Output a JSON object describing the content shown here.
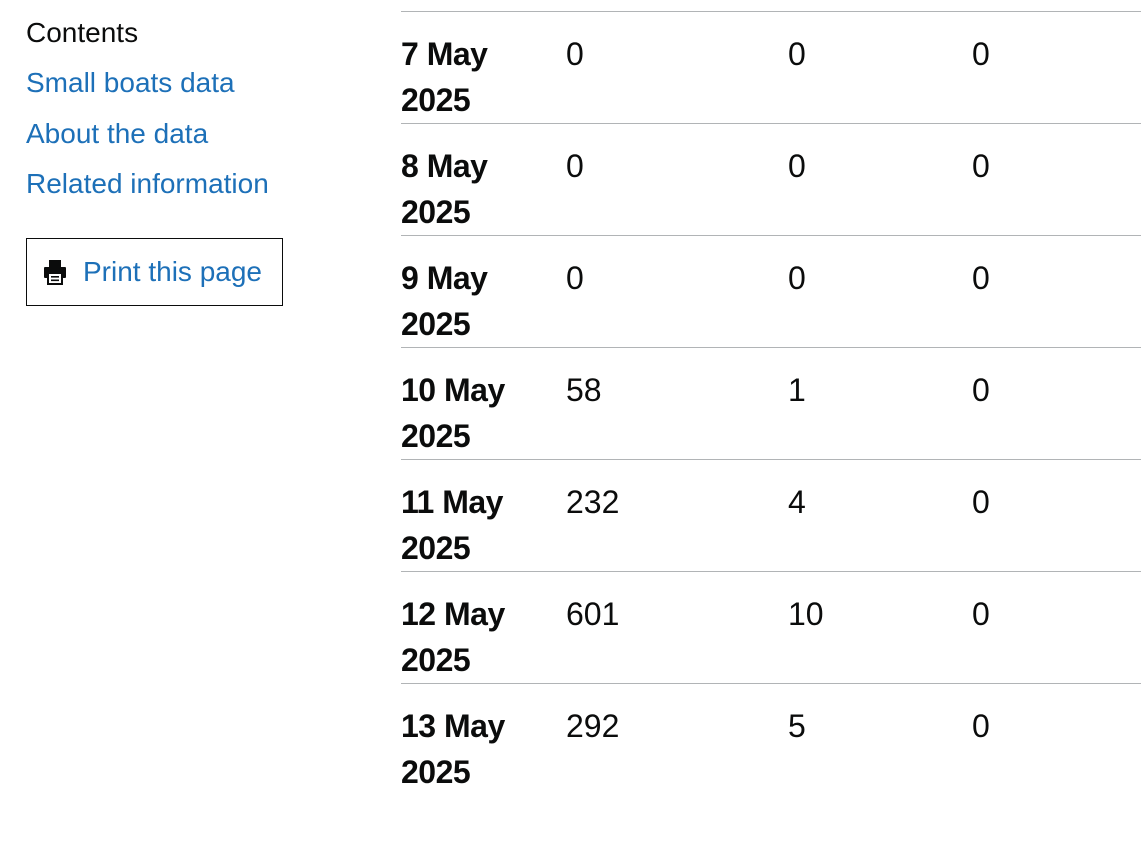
{
  "sidebar": {
    "heading": "Contents",
    "links": [
      {
        "label": "Small boats data"
      },
      {
        "label": "About the data"
      },
      {
        "label": "Related information"
      }
    ],
    "print_button": {
      "label": "Print this page",
      "icon": "printer-icon"
    }
  },
  "table": {
    "rows": [
      {
        "date_line1": "7 May",
        "date_line2": "2025",
        "c1": "0",
        "c2": "0",
        "c3": "0"
      },
      {
        "date_line1": "8 May",
        "date_line2": "2025",
        "c1": "0",
        "c2": "0",
        "c3": "0"
      },
      {
        "date_line1": "9 May",
        "date_line2": "2025",
        "c1": "0",
        "c2": "0",
        "c3": "0"
      },
      {
        "date_line1": "10 May",
        "date_line2": "2025",
        "c1": "58",
        "c2": "1",
        "c3": "0"
      },
      {
        "date_line1": "11 May",
        "date_line2": "2025",
        "c1": "232",
        "c2": "4",
        "c3": "0"
      },
      {
        "date_line1": "12 May",
        "date_line2": "2025",
        "c1": "601",
        "c2": "10",
        "c3": "0"
      },
      {
        "date_line1": "13 May",
        "date_line2": "2025",
        "c1": "292",
        "c2": "5",
        "c3": "0"
      }
    ]
  },
  "colors": {
    "link": "#1d70b8",
    "text": "#0b0c0c",
    "border": "#b1b4b6"
  }
}
